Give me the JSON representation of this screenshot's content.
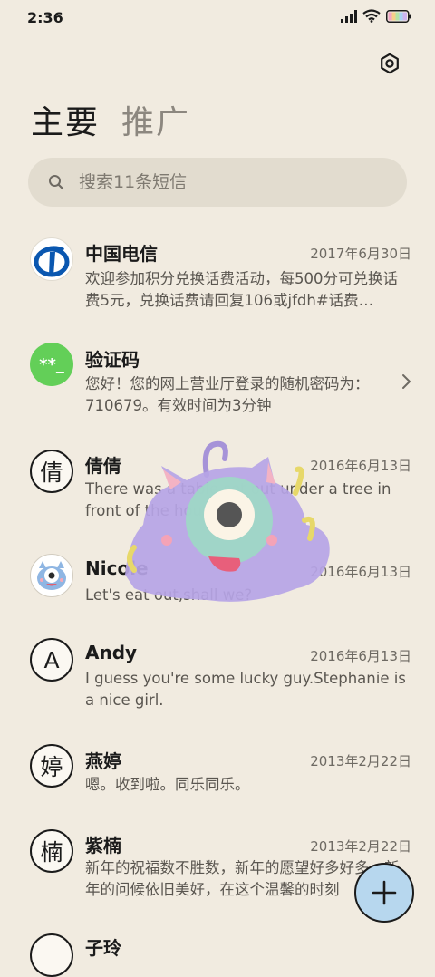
{
  "status_bar": {
    "time": "2:36",
    "icons": [
      "signal-icon",
      "wifi-icon",
      "battery-icon"
    ]
  },
  "header": {
    "tabs": [
      {
        "label": "主要",
        "active": true
      },
      {
        "label": "推广",
        "active": false
      }
    ],
    "settings_icon": "settings-icon"
  },
  "search": {
    "placeholder": "搜索11条短信"
  },
  "messages": [
    {
      "sender": "中国电信",
      "date": "2017年6月30日",
      "preview": "欢迎参加积分兑换话费活动，每500分可兑换话费5元，兑换话费请回复106或jfdh#话费…",
      "avatar": "telecom-logo"
    },
    {
      "sender": "验证码",
      "date": "",
      "preview": "您好！您的网上营业厅登录的随机密码为：710679。有效时间为3分钟",
      "avatar_text": "**_"
    },
    {
      "sender": "倩倩",
      "date": "2016年6月13日",
      "preview": "There was a table set out under a tree in front of the hous",
      "avatar_text": "倩"
    },
    {
      "sender": "Nicole",
      "date": "2016年6月13日",
      "preview": "Let's eat out,shall we?",
      "avatar": "cartoon-avatar"
    },
    {
      "sender": "Andy",
      "date": "2016年6月13日",
      "preview": "I guess you're some lucky guy.Stephanie is a nice girl.",
      "avatar_text": "A"
    },
    {
      "sender": "燕婷",
      "date": "2013年2月22日",
      "preview": "嗯。收到啦。同乐同乐。",
      "avatar_text": "婷"
    },
    {
      "sender": "紫楠",
      "date": "2013年2月22日",
      "preview": "新年的祝福数不胜数，新年的愿望好多好多，新年的问候依旧美好，在这个温馨的时刻",
      "avatar_text": "楠"
    },
    {
      "sender": "子玲",
      "date": "",
      "preview": "",
      "avatar_text": ""
    }
  ],
  "fab": {
    "icon": "plus-icon"
  },
  "colors": {
    "background": "#f1ebe0",
    "search_bg": "#e2dccf",
    "fab_bg": "#b7d7ee",
    "code_avatar": "#63cf58",
    "telecom_blue": "#0a57b0"
  }
}
